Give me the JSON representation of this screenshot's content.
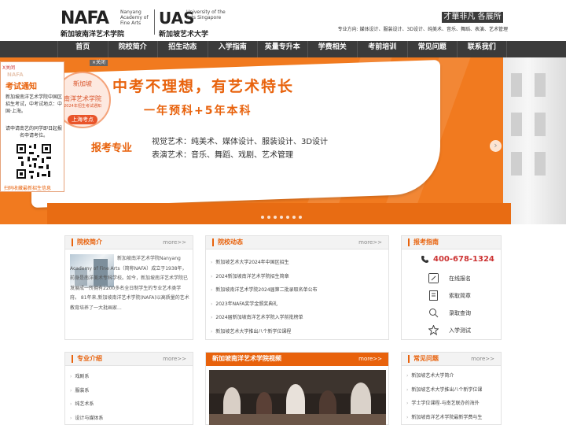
{
  "header": {
    "nafa_logo": "NAFA",
    "nafa_sub": "Nanyang Academy of Fine Arts",
    "nafa_cn": "新加坡南洋艺术学院",
    "uas_logo": "UAS",
    "uas_sub": "University of the Arts Singapore",
    "uas_cn": "新加坡艺术大学",
    "slogan": "才華非凡 各展所長",
    "majors": "专业方向: 媒体设计、服装设计、3D设计、纯美术、音乐、舞蹈、表演、艺术管理"
  },
  "nav": {
    "items": [
      "首页",
      "院校简介",
      "招生动态",
      "入学指南",
      "英量专升本",
      "学费相关",
      "考前培训",
      "常见问题",
      "联系我们"
    ]
  },
  "banner": {
    "headline": "中考不理想，有艺术特长",
    "subheadline": "一年预科+5年本科",
    "badge_l1": "新加坡",
    "badge_l2": "南洋艺术学院",
    "badge_l3": "2024年招生考试通知",
    "badge_pill": "上海考点",
    "enroll_label": "报考专业",
    "line1": "视觉艺术：纯美术、媒体设计、服装设计、3D设计",
    "line2": "表演艺术：音乐、舞蹈、戏剧、艺术管理",
    "close_label": "×关闭"
  },
  "float_panel": {
    "close": "X关闭",
    "watermark": "NAFA",
    "title": "考试通知",
    "desc": "新加坡南洋艺术学院中国区招生考试，中考试地点：中国·上海。",
    "tip": "请申请南艺的同学即日起报名申请考位。",
    "scan": "扫码收藏最新招生信息"
  },
  "about": {
    "title": "院校简介",
    "more": "more>>",
    "text": "新加坡南洋艺术学院Nanyang Academy of Fine Arts（简称NAFA）成立于1938年，前身是南洋美术专科学校。如今，新加坡南洋艺术学院已发展成一所拥有2200多名全日制学生的专业艺术类学府。 81年来,新加坡南洋艺术学院(NAFA)以高质量的艺术教育培养了一大批画家..."
  },
  "news": {
    "title": "院校动态",
    "more": "more>>",
    "items": [
      "新加坡艺术大学2024年中国区招生",
      "2024新加坡南洋艺术学院招生简章",
      "新加坡南洋艺术学院2024届第二批录取名单公布",
      "2023年NAFA奖学金颁奖典礼",
      "2024届新加坡南洋艺术学院入学前批榜单",
      "新加坡艺术大学推出八个新学位课程"
    ]
  },
  "guide": {
    "title": "报考指南",
    "phone": "400-678-1324",
    "services": [
      "在线报名",
      "索取简章",
      "录取查询",
      "入学测试"
    ]
  },
  "majors_panel": {
    "title": "专业介绍",
    "more": "more>>",
    "items": [
      "戏剧系",
      "服装系",
      "纯艺术系",
      "设计与媒体系"
    ]
  },
  "video": {
    "title": "新加坡南洋艺术学院视频",
    "more": "more>>"
  },
  "faq": {
    "title": "常见问题",
    "more": "more>>",
    "items": [
      "新加坡艺术大学简介",
      "新加坡艺术大学推出八个新学位课",
      "学士学位课程-与南艺联办的海外",
      "新加坡南洋艺术学院最新学费与生"
    ]
  }
}
